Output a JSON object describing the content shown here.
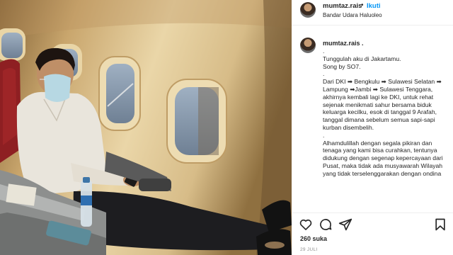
{
  "post": {
    "username": "mumtaz.rais",
    "separator": "•",
    "follow_label": "Ikuti",
    "location": "Bandar Udara Haluoleo"
  },
  "caption": {
    "username": "mumtaz.rais",
    "username_suffix": " .",
    "text": ".\nTunggulah aku di Jakartamu.\nSong by SO7.\n.\nDari DKI ➡ Bengkulu ➡ Sulawesi Selatan ➡ Lampung ➡Jambi ➡ Sulawesi Tenggara, akhirnya kembali lagi ke DKI, untuk rehat sejenak menikmati sahur bersama biduk keluarga kecilku, esok di tanggal 9 Arafah, tanggal dimana sebelum semua sapi-sapi kurban disembelih.\n.\nAlhamdulillah dengan segala pikiran dan tenaga yang kami bisa curahkan, tentunya didukung dengan segenap kepercayaan dari Pusat, maka tidak ada musyawarah Wilayah yang tidak terselenggarakan dengan ondina"
  },
  "actions": {
    "like_icon": "heart-icon",
    "comment_icon": "comment-icon",
    "share_icon": "share-icon",
    "save_icon": "bookmark-icon",
    "likes_label": "260 suka",
    "date": "29 JULI"
  },
  "colors": {
    "follow_blue": "#0095f6",
    "text_primary": "#262626",
    "text_secondary": "#8e8e8e"
  }
}
